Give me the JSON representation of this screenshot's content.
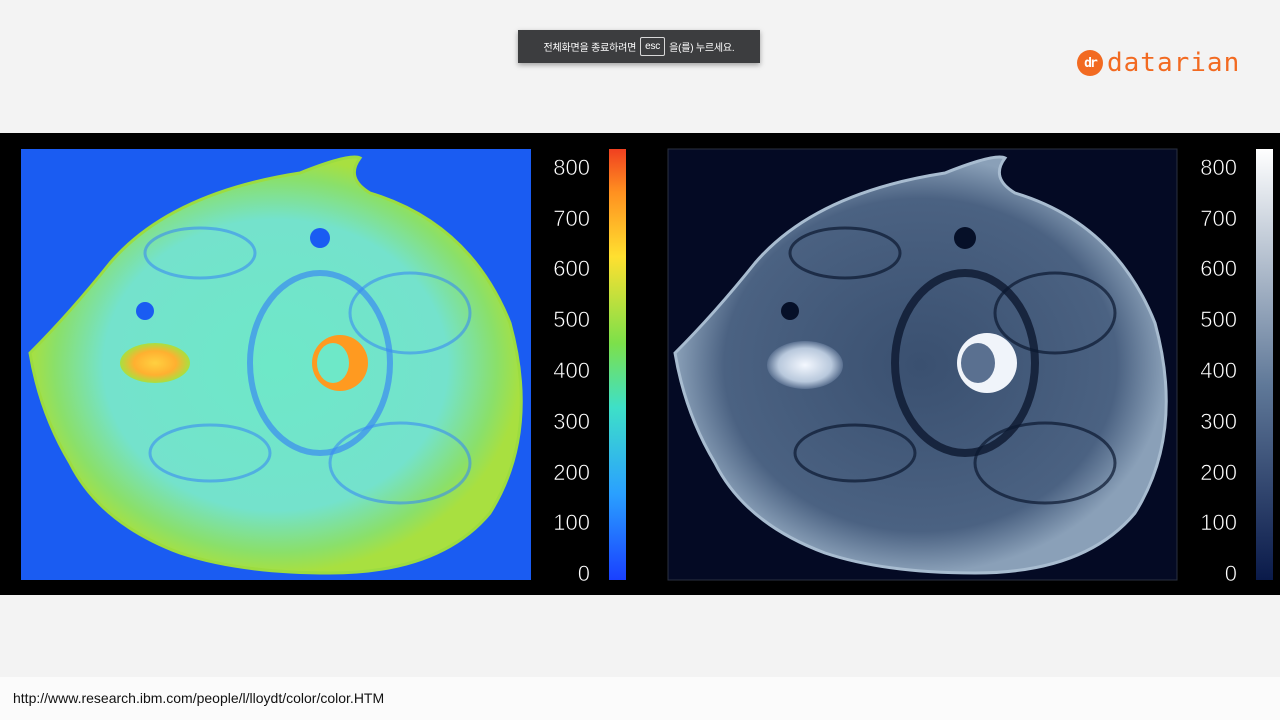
{
  "overlay": {
    "text_before": "전체화면을 종료하려면",
    "key": "esc",
    "text_after": "을(를) 누르세요."
  },
  "logo": {
    "mark": "dr",
    "name": "datarian",
    "color": "#f26a21"
  },
  "figure": {
    "left_colorbar": {
      "ticks": [
        "800",
        "700",
        "600",
        "500",
        "400",
        "300",
        "200",
        "100",
        "0"
      ],
      "colormap": "jet"
    },
    "right_colorbar": {
      "ticks": [
        "800",
        "700",
        "600",
        "500",
        "400",
        "300",
        "200",
        "100",
        "0"
      ],
      "colormap": "gray-blue"
    }
  },
  "footer": {
    "source_url": "http://www.research.ibm.com/people/l/lloydt/color/color.HTM"
  }
}
